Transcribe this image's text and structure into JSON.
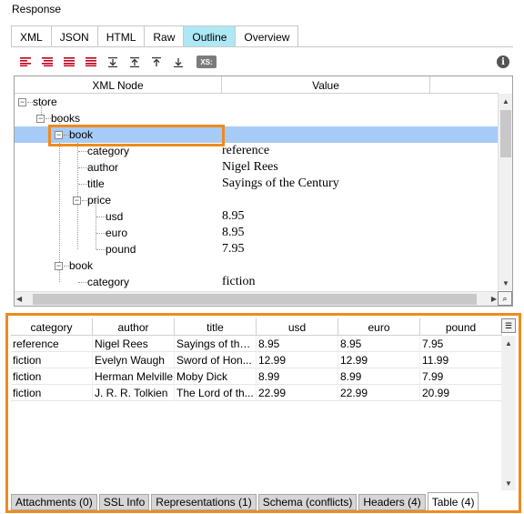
{
  "panel": {
    "title": "Response"
  },
  "tabs": [
    {
      "label": "XML"
    },
    {
      "label": "JSON"
    },
    {
      "label": "HTML"
    },
    {
      "label": "Raw"
    },
    {
      "label": "Outline"
    },
    {
      "label": "Overview"
    }
  ],
  "active_tab": "Outline",
  "toolbar": {
    "xs_badge": "XS:",
    "info_icon": "i",
    "icons": [
      "align-left-icon",
      "align-center-icon",
      "align-right-icon",
      "justify-icon",
      "expand-down-icon",
      "collapse-up-icon",
      "move-top-icon",
      "move-bottom-icon"
    ]
  },
  "tree": {
    "columns": {
      "node": "XML Node",
      "value": "Value"
    },
    "rows": [
      {
        "node": "store",
        "value": ""
      },
      {
        "node": "books",
        "value": ""
      },
      {
        "node": "book",
        "value": ""
      },
      {
        "node": "category",
        "value": "reference"
      },
      {
        "node": "author",
        "value": "Nigel Rees"
      },
      {
        "node": "title",
        "value": "Sayings of the Century"
      },
      {
        "node": "price",
        "value": ""
      },
      {
        "node": "usd",
        "value": "8.95"
      },
      {
        "node": "euro",
        "value": "8.95"
      },
      {
        "node": "pound",
        "value": "7.95"
      },
      {
        "node": "book",
        "value": ""
      },
      {
        "node": "category",
        "value": "fiction"
      }
    ]
  },
  "table": {
    "columns": [
      "category",
      "author",
      "title",
      "usd",
      "euro",
      "pound"
    ],
    "rows": [
      [
        "reference",
        "Nigel Rees",
        "Sayings of the ...",
        "8.95",
        "8.95",
        "7.95"
      ],
      [
        "fiction",
        "Evelyn Waugh",
        "Sword of Hon...",
        "12.99",
        "12.99",
        "11.99"
      ],
      [
        "fiction",
        "Herman Melville",
        "Moby Dick",
        "8.99",
        "8.99",
        "7.99"
      ],
      [
        "fiction",
        "J. R. R. Tolkien",
        "The Lord of th...",
        "22.99",
        "22.99",
        "20.99"
      ]
    ]
  },
  "bottom_tabs": [
    {
      "label": "Attachments (0)"
    },
    {
      "label": "SSL Info"
    },
    {
      "label": "Representations (1)"
    },
    {
      "label": "Schema (conflicts)"
    },
    {
      "label": "Headers (4)"
    },
    {
      "label": "Table (4)"
    }
  ],
  "active_bottom_tab": "Table (4)",
  "colors": {
    "active_tab": "#aee8f5",
    "selection": "#a6cbf7",
    "highlight": "#f08a1e"
  }
}
